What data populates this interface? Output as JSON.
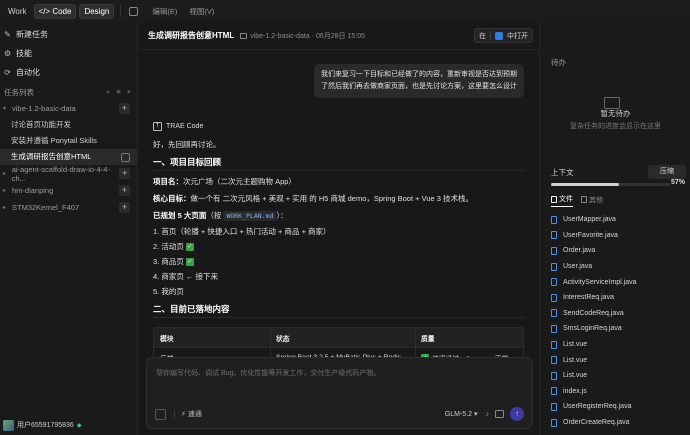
{
  "topbar": {
    "modes": [
      "Work",
      "</> Code",
      "Design"
    ],
    "menu": [
      "编辑(E)",
      "视图(V)"
    ]
  },
  "sidebar": {
    "nav": [
      {
        "icon": "new-task-icon",
        "label": "新建任务"
      },
      {
        "icon": "skills-icon",
        "label": "技能"
      },
      {
        "icon": "automation-icon",
        "label": "自动化"
      }
    ],
    "task_header": "任务列表",
    "groups": [
      {
        "label": "vibe-1.2-basic-data",
        "subs": [
          "讨论首页功能开发",
          "安装并遵循 Ponytail Skills",
          "生成调研报告创意HTML"
        ]
      },
      {
        "label": "ai-agent-scaffold-draw-io-4-4-ch..."
      },
      {
        "label": "hm-dianping"
      },
      {
        "label": "STM32Kernel_F407"
      }
    ],
    "user": "用户65591795836"
  },
  "main": {
    "title": "生成调研报告创意HTML",
    "meta": "vibe-1.2-basic-data · 06月28日 15:05",
    "open_in": "在",
    "open_target": "中打开",
    "user_message": "我们来复习一下目标和已经做了的内容，重新审视是否达到预期了然后我们再去做商家页面，也是先讨论方案，这里要怎么设计",
    "agent": "TRAE Code",
    "lines": {
      "l1": "好，先回顾再讨论。",
      "h1": "一、项目目标回顾",
      "p1a": "项目名：",
      "p1b": "次元广场（二次元主题购物 App）",
      "p2a": "核心目标：",
      "p2b": "做一个有 二次元风格 + 美观 + 实用 的 H5 商城 demo，Spring Boot + Vue 3 技术栈。",
      "p3a": "已规划 5 大页面",
      "p3b": "（按 ",
      "p3code": "WORK_PLAN.md",
      "p3c": "）：",
      "items": [
        "1. 首页（轮播 + 快捷入口 + 热门活动 + 商品 + 商家）",
        "2. 活动页",
        "3. 商品页",
        "4. 商家页 ← 接下来",
        "5. 我的页"
      ],
      "h2": "二、目前已落地内容"
    },
    "table": {
      "headers": [
        "模块",
        "状态",
        "质量"
      ],
      "rows": [
        [
          "后端",
          "Spring Boot 3.2.5 + MyBatis-Plus + Redis",
          "编译通过，Swagger 正常"
        ]
      ]
    },
    "composer": {
      "placeholder": "帮你编写代码、调试 Bug、优化性能等开发工作，交付生产级代码产物。",
      "speed": "速通",
      "model": "GLM-5.2"
    }
  },
  "right": {
    "title": "待办",
    "empty_title": "暂无待办",
    "empty_sub": "复杂任务的进度会显示在这里",
    "context_label": "上下文",
    "compress": "压缩",
    "context_percent": "57%",
    "context_fraction": 0.57,
    "tabs": [
      "文件",
      "其他"
    ],
    "files": [
      "UserMapper.java",
      "UserFavorite.java",
      "Order.java",
      "User.java",
      "ActivityServiceImpl.java",
      "InterestReq.java",
      "SendCodeReq.java",
      "SmsLoginReq.java",
      "List.vue",
      "List.vue",
      "List.vue",
      "index.js",
      "UserRegisterReq.java",
      "OrderCreateReq.java"
    ]
  }
}
